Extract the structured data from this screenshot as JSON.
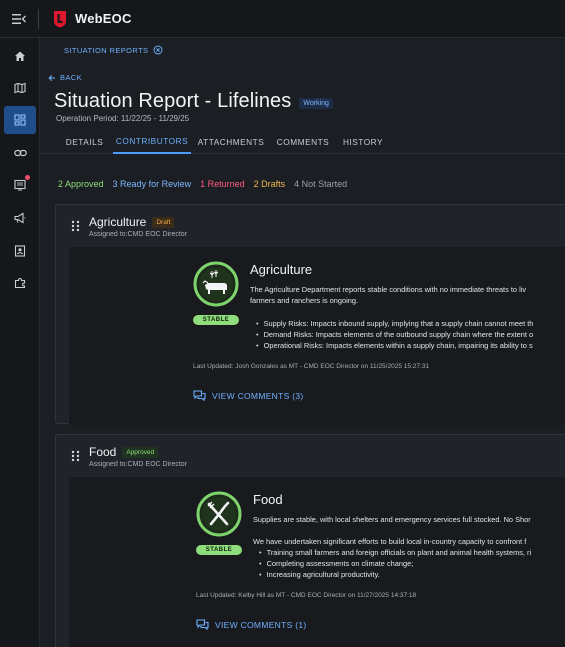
{
  "app": {
    "title": "WebEOC"
  },
  "sidebar": {
    "items": [
      {
        "name": "home"
      },
      {
        "name": "map"
      },
      {
        "name": "dashboard"
      },
      {
        "name": "link"
      },
      {
        "name": "board"
      },
      {
        "name": "announcements"
      },
      {
        "name": "contacts"
      },
      {
        "name": "plugins"
      }
    ]
  },
  "breadcrumb": {
    "label": "SITUATION REPORTS"
  },
  "back": {
    "label": "BACK"
  },
  "page": {
    "title": "Situation Report - Lifelines",
    "status_badge": "Working",
    "operation_period": "Operation Period: 11/22/25 - 11/29/25"
  },
  "tabs": [
    "DETAILS",
    "CONTRIBUTORS",
    "ATTACHMENTS",
    "COMMENTS",
    "HISTORY"
  ],
  "active_tab": "CONTRIBUTORS",
  "status_summary": {
    "approved": "2 Approved",
    "ready": "3 Ready for Review",
    "returned": "1 Returned",
    "drafts": "2 Drafts",
    "not_started": "4 Not Started"
  },
  "colors": {
    "accent": "#4f9cff",
    "approved": "#8fdc7a",
    "returned": "#ff5d7e",
    "drafts": "#f2b84b",
    "stable": "#8fdc7a"
  },
  "cards": [
    {
      "title": "Agriculture",
      "badge": "Draft",
      "assigned": "Assigned to:CMD EOC Director",
      "icon": "cow-wheat-icon",
      "status": "STABLE",
      "sector_title": "Agriculture",
      "summary_lines": [
        "The Agriculture Department reports stable conditions with no immediate threats to liv",
        "farmers and ranchers is ongoing."
      ],
      "bullets": [
        "Supply Risks: Impacts inbound supply, implying that a supply chain cannot meet th",
        "Demand Risks: Impacts elements of the outbound supply chain where the extent o",
        "Operational Risks: Impacts elements within a supply chain, impairing its ability to s"
      ],
      "last_updated": "Last Updated: Josh Gonzales as MT - CMD EOC Director on 11/25/2025 15:27:31",
      "view_comments": "VIEW COMMENTS (3)"
    },
    {
      "title": "Food",
      "badge": "Approved",
      "assigned": "Assigned to:CMD EOC Director",
      "icon": "fork-knife-icon",
      "status": "STABLE",
      "sector_title": "Food",
      "summary_lines": [
        "Supplies are stable, with local shelters and emergency services full stocked. No Shor",
        "",
        "We have undertaken significant efforts to build local in-country capacity to confront f"
      ],
      "bullets": [
        "Training small farmers and foreign officials on plant and animal health systems, ri",
        "Completing assessments on climate change;",
        "Increasing agricultural productivity."
      ],
      "last_updated": "Last Updated: Kelby Hill as MT - CMD EOC Director on 11/27/2025 14:37:18",
      "view_comments": "VIEW COMMENTS (1)"
    }
  ]
}
